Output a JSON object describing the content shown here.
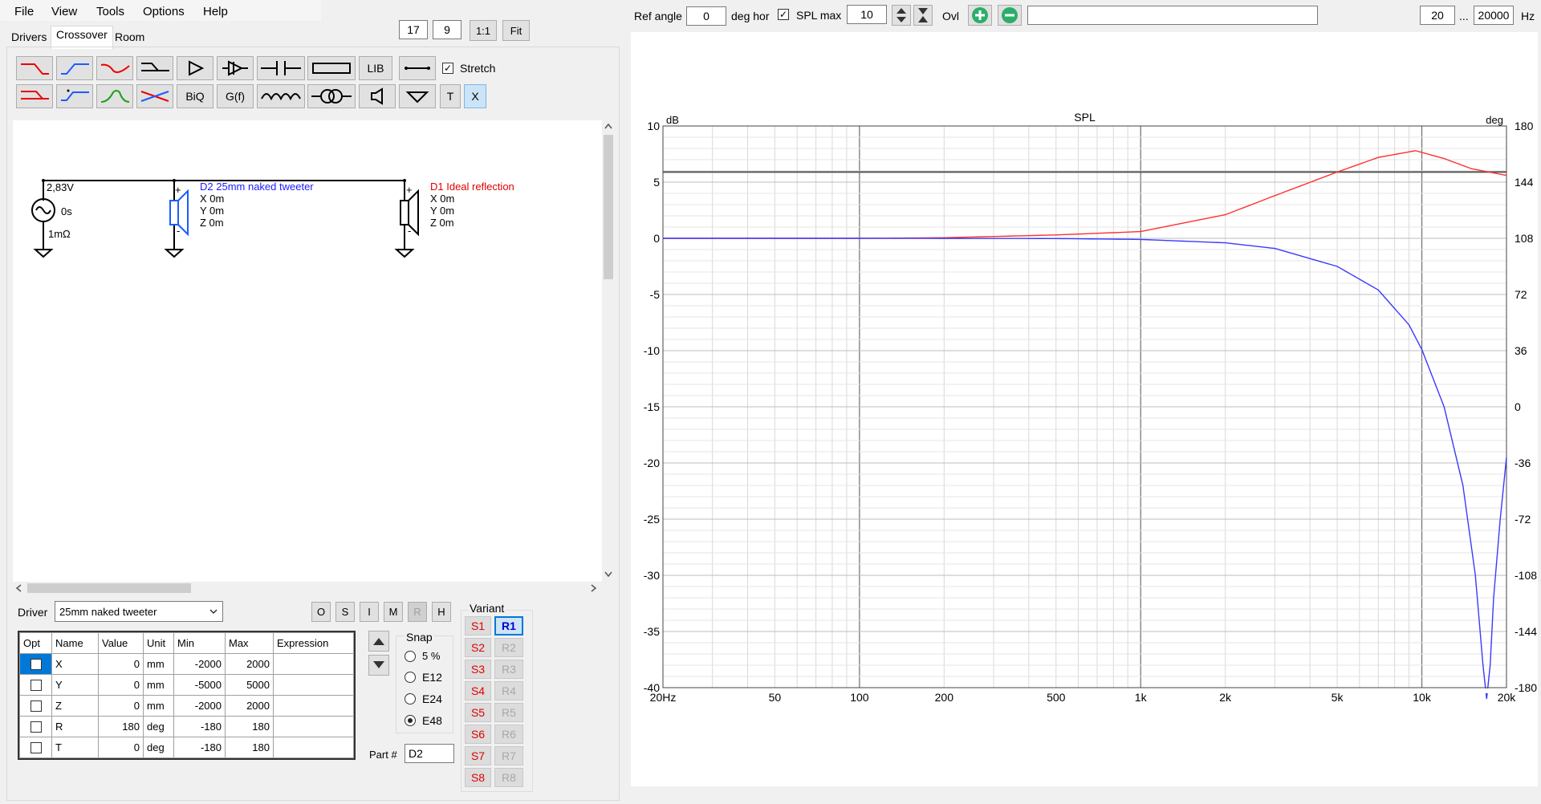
{
  "menu": {
    "file": "File",
    "view": "View",
    "tools": "Tools",
    "options": "Options",
    "help": "Help"
  },
  "tabs": [
    "Drivers",
    "Crossover",
    "Room"
  ],
  "zoom": {
    "a": "17",
    "b": "9",
    "one": "1:1",
    "fit": "Fit"
  },
  "toolbar": {
    "lib": "LIB",
    "biq": "BiQ",
    "gf": "G(f)",
    "t": "T",
    "x": "X",
    "stretch": "Stretch",
    "stretch_checked": true
  },
  "top": {
    "ref_angle_label": "Ref angle",
    "ref_angle": "0",
    "deg_hor": "deg hor",
    "spl_max_label": "SPL max",
    "spl_max_checked": true,
    "spl_max": "10",
    "ovl": "Ovl",
    "ovl_text": "",
    "f_min": "20",
    "ellipsis": "...",
    "f_max": "20000",
    "hz": "Hz"
  },
  "schematic": {
    "source": {
      "voltage": "2,83V",
      "delay": "0s",
      "resistance": "1mΩ"
    },
    "d2": {
      "title": "D2 25mm naked tweeter",
      "x": "X 0m",
      "y": "Y 0m",
      "z": "Z 0m",
      "color": "#1c1cff"
    },
    "d1": {
      "title": "D1 Ideal reflection",
      "x": "X 0m",
      "y": "Y 0m",
      "z": "Z 0m",
      "color": "#e00000"
    },
    "plus": "+",
    "minus": "-"
  },
  "driver_panel": {
    "label": "Driver",
    "selected": "25mm naked tweeter",
    "mode_buttons": [
      "O",
      "S",
      "I",
      "M",
      "R",
      "H"
    ],
    "headers": [
      "Opt",
      "Name",
      "Value",
      "Unit",
      "Min",
      "Max",
      "Expression"
    ],
    "rows": [
      {
        "name": "X",
        "value": "0",
        "unit": "mm",
        "min": "-2000",
        "max": "2000",
        "expr": ""
      },
      {
        "name": "Y",
        "value": "0",
        "unit": "mm",
        "min": "-5000",
        "max": "5000",
        "expr": ""
      },
      {
        "name": "Z",
        "value": "0",
        "unit": "mm",
        "min": "-2000",
        "max": "2000",
        "expr": ""
      },
      {
        "name": "R",
        "value": "180",
        "unit": "deg",
        "min": "-180",
        "max": "180",
        "expr": ""
      },
      {
        "name": "T",
        "value": "0",
        "unit": "deg",
        "min": "-180",
        "max": "180",
        "expr": ""
      }
    ],
    "snap_label": "Snap",
    "snap_options": [
      "5 %",
      "E12",
      "E24",
      "E48"
    ],
    "snap_selected": "E48",
    "part_label": "Part #",
    "part": "D2",
    "variant_label": "Variant",
    "s_variants": [
      "S1",
      "S2",
      "S3",
      "S4",
      "S5",
      "S6",
      "S7",
      "S8"
    ],
    "r_variants": [
      "R1",
      "R2",
      "R3",
      "R4",
      "R5",
      "R6",
      "R7",
      "R8"
    ],
    "active_r": "R1"
  },
  "chart_data": {
    "type": "line",
    "title": "SPL",
    "ylabel": "dB",
    "y2label": "deg",
    "xscale": "log",
    "xlim": [
      20,
      20000
    ],
    "ylim": [
      -40,
      10
    ],
    "y2lim": [
      -180,
      180
    ],
    "x_ticks": [
      "20Hz",
      "50",
      "100",
      "200",
      "500",
      "1k",
      "2k",
      "5k",
      "10k",
      "20k"
    ],
    "y_ticks": [
      "10",
      "5",
      "0",
      "-5",
      "-10",
      "-15",
      "-20",
      "-25",
      "-30",
      "-35",
      "-40"
    ],
    "y2_ticks": [
      "180",
      "144",
      "108",
      "72",
      "36",
      "0",
      "-36",
      "-72",
      "-108",
      "-144",
      "-180"
    ],
    "spl_max_line": 5.9,
    "grid": true,
    "series": [
      {
        "color": "#ff3030",
        "x": [
          20,
          100,
          200,
          500,
          1000,
          2000,
          3000,
          5000,
          7000,
          9500,
          12000,
          15000,
          20000
        ],
        "y": [
          0,
          0,
          0.05,
          0.3,
          0.6,
          2.1,
          3.8,
          5.9,
          7.2,
          7.8,
          7.1,
          6.2,
          5.6
        ]
      },
      {
        "color": "#3a3aff",
        "x": [
          20,
          100,
          500,
          1000,
          2000,
          3000,
          5000,
          7000,
          9000,
          10000,
          12000,
          14000,
          15500,
          16500,
          17000,
          17500,
          18000,
          19000,
          20000
        ],
        "y": [
          0,
          0,
          -0.02,
          -0.1,
          -0.4,
          -0.9,
          -2.5,
          -4.6,
          -7.7,
          -9.9,
          -15,
          -22,
          -30,
          -38,
          -41,
          -38,
          -32,
          -25,
          -19.5
        ]
      }
    ]
  }
}
